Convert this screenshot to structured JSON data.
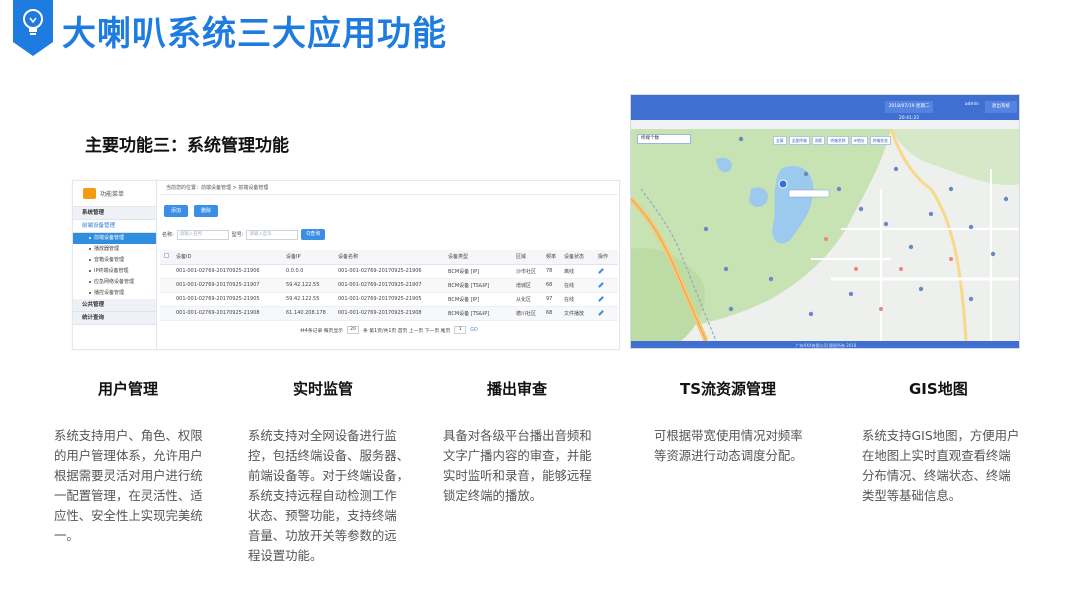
{
  "header": {
    "title": "大喇叭系统三大应用功能",
    "subtitle": "主要功能三：系统管理功能",
    "badge_color": "#1e7be0",
    "badge_icon": "lightbulb-icon"
  },
  "device_mgmt": {
    "sidebar": {
      "title": "功能菜单",
      "groups": [
        {
          "label": "系统管理"
        },
        {
          "label": "前端设备管理",
          "items": [
            "前端设备管理",
            "播放器管理",
            "音箱设备管理",
            "IP终端设备管理",
            "应急网络设备管理",
            "播控设备管理"
          ]
        },
        {
          "label": "公共管理"
        },
        {
          "label": "统计查询"
        }
      ]
    },
    "breadcrumb": "当前您的位置：前端设备管理 > 前端设备管理",
    "add_label": "添加",
    "delete_label": "删除",
    "filter": {
      "name_label": "名称:",
      "name_placeholder": "请输入名称",
      "type_label": "型号:",
      "type_placeholder": "请输入型号",
      "search_label": "Q查询"
    },
    "columns": [
      "设备ID",
      "设备IP",
      "设备名称",
      "设备类型",
      "区域",
      "频率",
      "设备状态",
      "操作"
    ],
    "rows": [
      [
        "001-001-02769-20170925-21906",
        "0.0.0.0",
        "001-001-02769-20170925-21906",
        "BCM设备 [IP]",
        "沙市社区",
        "78",
        "离线"
      ],
      [
        "001-001-02769-20170925-21907",
        "59.42.122.55",
        "001-001-02769-20170925-21907",
        "BCM设备 [TS&IP]",
        "增城区",
        "68",
        "在线"
      ],
      [
        "001-001-02769-20170925-21905",
        "59.42.122.55",
        "001-001-02769-20170925-21905",
        "BCM设备 [IP]",
        "从化区",
        "97",
        "在线"
      ],
      [
        "001-001-02769-20170925-21908",
        "61.140.208.178",
        "001-001-02769-20170925-21908",
        "BCM设备 [TS&IP]",
        "德川社区",
        "68",
        "文件播放"
      ]
    ],
    "pager": {
      "total": "共4条记录 每页显示",
      "per_page": "20",
      "info": "条 第1页/共1页 首页 上一页 下一页 尾页",
      "page": "1",
      "go": "GO"
    }
  },
  "gis_map": {
    "time": "2018/07/19 星期二 20:41:22",
    "user": "admin",
    "logout": "退出系统",
    "panel_title": "终端个数",
    "tools": [
      "全屏",
      "全部终端",
      "测距",
      "终端名称",
      "IP地址",
      "终端状态"
    ],
    "footer": "广州XXX有限公司 版权所有 2018"
  },
  "features": [
    {
      "title": "用户管理",
      "lines": [
        "系统支持用户、角色、权限",
        "的用户管理体系，允许用户",
        "根据需要灵活对用户进行统",
        "一配置管理，在灵活性、适",
        "应性、安全性上实现完美统",
        "一。"
      ]
    },
    {
      "title": "实时监管",
      "lines": [
        "系统支持对全网设备进行监",
        "控，包括终端设备、服务器、",
        "前端设备等。对于终端设备，",
        "系统支持远程自动检测工作",
        "状态、预警功能，支持终端",
        "音量、功放开关等参数的远",
        "程设置功能。"
      ]
    },
    {
      "title": "播出审查",
      "lines": [
        "具备对各级平台播出音频和",
        "文字广播内容的审查，并能",
        "实时监听和录音，能够远程",
        "锁定终端的播放。"
      ]
    },
    {
      "title": "TS流资源管理",
      "lines": [
        "可根据带宽使用情况对频率",
        "等资源进行动态调度分配。"
      ]
    },
    {
      "title": "GIS地图",
      "lines": [
        "系统支持GIS地图，方便用户",
        "在地图上实时直观查看终端",
        "分布情况、终端状态、终端",
        "类型等基础信息。"
      ]
    }
  ]
}
